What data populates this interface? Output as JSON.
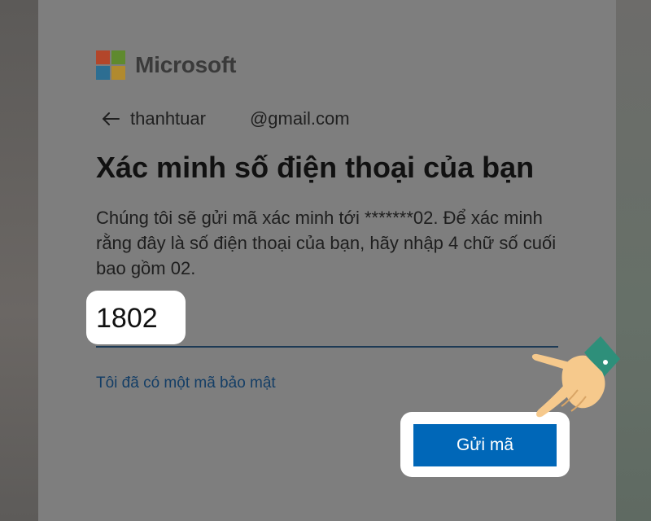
{
  "brand": {
    "name": "Microsoft",
    "logo_colors": [
      "#f25022",
      "#7fba00",
      "#00a4ef",
      "#ffb900"
    ]
  },
  "identity": {
    "back_icon": "arrow-left-icon",
    "user": "thanhtuar",
    "domain": "@gmail.com"
  },
  "page": {
    "title": "Xác minh số điện thoại của bạn",
    "description": "Chúng tôi sẽ gửi mã xác minh tới *******02. Để xác minh rằng đây là số điện thoại của bạn, hãy nhập 4 chữ số cuối bao gồm 02."
  },
  "form": {
    "code_value": "1802",
    "have_code_link": "Tôi đã có một mã bảo mật",
    "send_button": "Gửi mã"
  },
  "colors": {
    "primary_button": "#0067b8",
    "link": "#143e66",
    "highlight": "#ffffff"
  },
  "pointer_icon": "pointing-hand-icon"
}
